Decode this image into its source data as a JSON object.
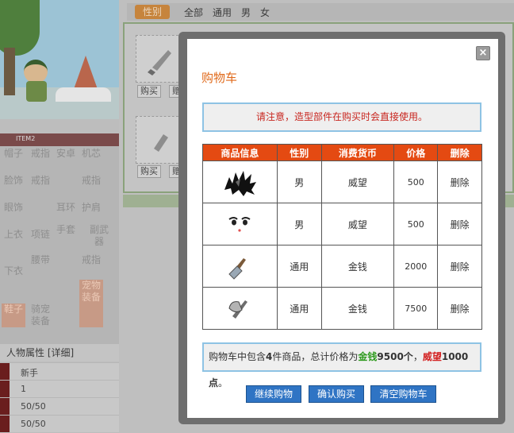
{
  "background": {
    "filter": {
      "tag_label": "性别",
      "options": [
        "全部",
        "通用",
        "男",
        "女"
      ]
    },
    "buy_labels": [
      "购买",
      "赠送"
    ],
    "tab_label": "ITEM2",
    "equip_slots": [
      [
        "帽子",
        "戒指",
        "安卓",
        "机芯"
      ],
      [
        "脸饰",
        "戒指",
        "",
        "戒指"
      ],
      [
        "眼饰",
        "",
        "耳环",
        "护肩"
      ],
      [
        "上衣",
        "项链",
        "手套",
        "副武器"
      ],
      [
        "下衣",
        "腰带",
        "",
        "戒指"
      ],
      [
        "鞋子",
        "骑宠装备",
        "",
        "宠物装备"
      ]
    ],
    "attr_title": "人物属性 [详细]",
    "attr_values": [
      "新手",
      "1",
      "50/50",
      "50/50"
    ]
  },
  "modal": {
    "title": "购物车",
    "close_label": "×",
    "notice": "请注意，造型部件在购买时会直接使用。",
    "columns": [
      "商品信息",
      "性别",
      "消费货币",
      "价格",
      "删除"
    ],
    "items": [
      {
        "icon": "hair-icon",
        "gender": "男",
        "currency": "威望",
        "price": "500",
        "delete": "删除"
      },
      {
        "icon": "face-icon",
        "gender": "男",
        "currency": "威望",
        "price": "500",
        "delete": "删除"
      },
      {
        "icon": "trowel-icon",
        "gender": "通用",
        "currency": "金钱",
        "price": "2000",
        "delete": "删除"
      },
      {
        "icon": "axe-icon",
        "gender": "通用",
        "currency": "金钱",
        "price": "7500",
        "delete": "删除"
      }
    ],
    "summary": {
      "prefix": "购物车中包含",
      "count": "4",
      "mid": "件商品，总计价格为",
      "gold_label": "金钱",
      "gold_amount": "9500个",
      "sep": "，",
      "prestige_label": "威望",
      "prestige_amount": "1000点",
      "suffix": "。"
    },
    "buttons": {
      "continue": "继续购物",
      "confirm": "确认购买",
      "clear": "清空购物车"
    }
  },
  "colors": {
    "accent": "#e44a12",
    "title": "#e06a1b",
    "button": "#2f74c4",
    "notice_border": "#8ec3e4",
    "gold": "#2e9a1e",
    "prestige": "#d32020"
  }
}
